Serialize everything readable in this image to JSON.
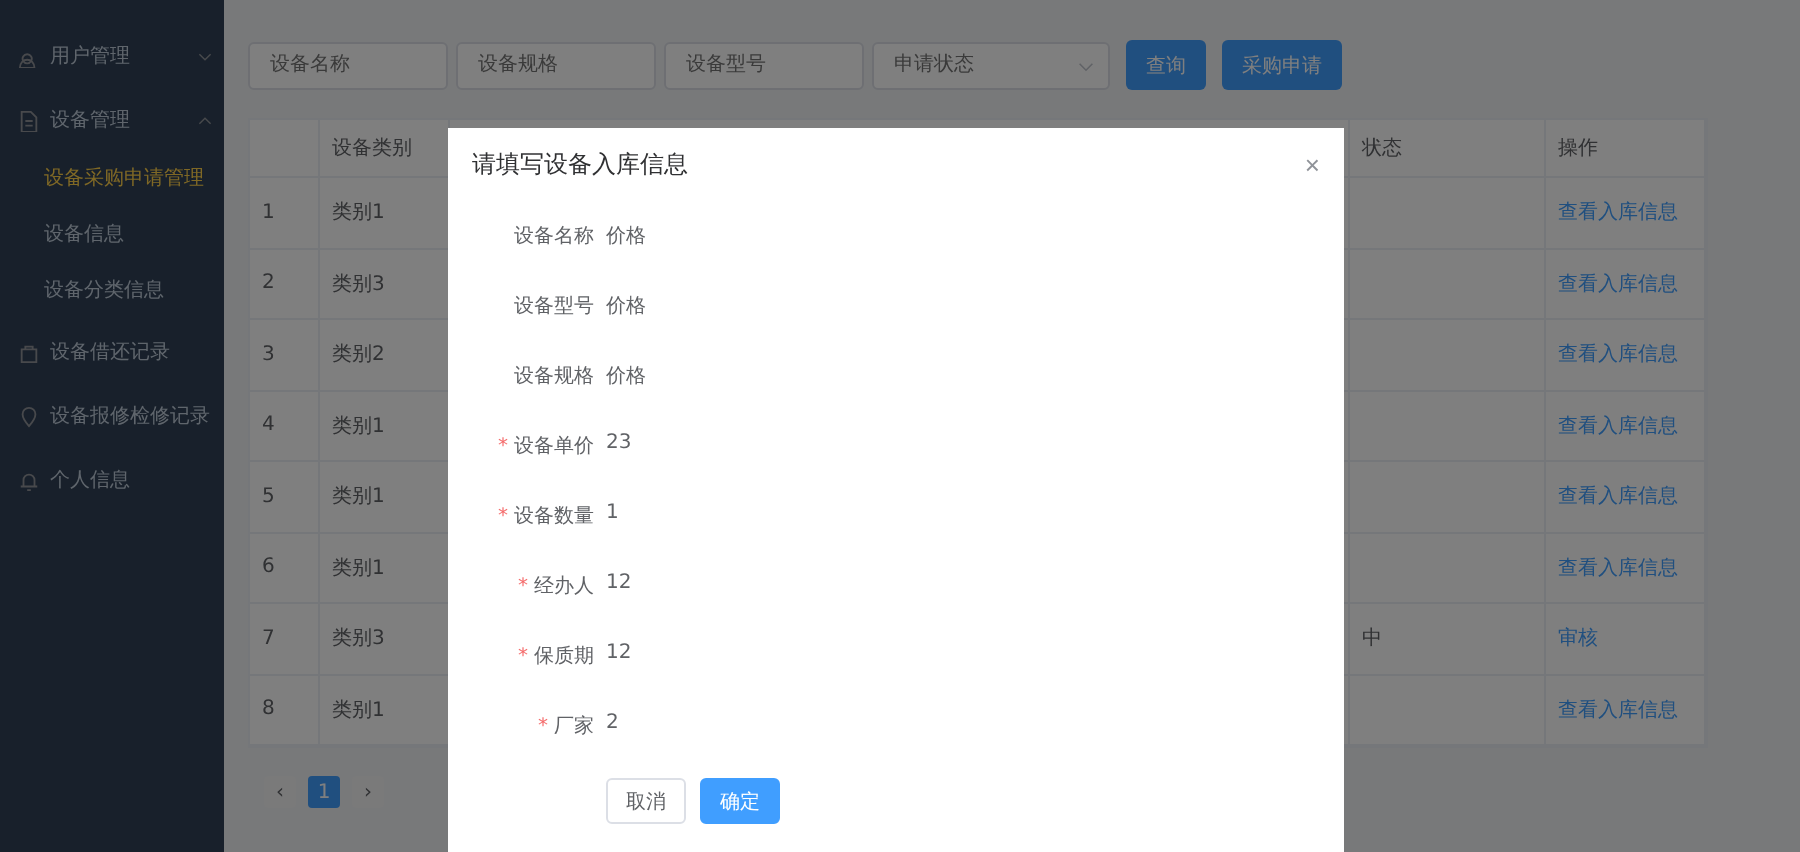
{
  "sidebar": {
    "items": [
      {
        "label": "用户管理",
        "expanded": false,
        "selected": false
      },
      {
        "label": "设备管理",
        "expanded": true,
        "selected": false,
        "children": [
          {
            "label": "设备采购申请管理",
            "selected": true
          },
          {
            "label": "设备信息",
            "selected": false
          },
          {
            "label": "设备分类信息",
            "selected": false
          }
        ]
      },
      {
        "label": "设备借还记录",
        "selected": false
      },
      {
        "label": "设备报修检修记录",
        "selected": false
      },
      {
        "label": "个人信息",
        "selected": false
      }
    ]
  },
  "filters": {
    "fields": [
      {
        "kind": "input",
        "placeholder": "设备名称"
      },
      {
        "kind": "input",
        "placeholder": "设备规格"
      },
      {
        "kind": "input",
        "placeholder": "设备型号"
      },
      {
        "kind": "select",
        "placeholder": "申请状态"
      }
    ],
    "buttons": [
      "查询",
      "采购申请"
    ]
  },
  "table": {
    "columns": [
      null,
      "设备类别",
      null,
      "状态",
      "操作"
    ],
    "rows": [
      {
        "index": "1",
        "category": "类别1",
        "action": "查看入库信息"
      },
      {
        "index": "2",
        "category": "类别3",
        "action": "查看入库信息"
      },
      {
        "index": "3",
        "category": "类别2",
        "action": "查看入库信息"
      },
      {
        "index": "4",
        "category": "类别1",
        "action": "查看入库信息"
      },
      {
        "index": "5",
        "category": "类别1",
        "action": "查看入库信息"
      },
      {
        "index": "6",
        "category": "类别1",
        "action": "查看入库信息"
      },
      {
        "index": "7",
        "category": "类别3",
        "status": "中",
        "action": "审核"
      },
      {
        "index": "8",
        "category": "类别1",
        "action": "查看入库信息"
      }
    ]
  },
  "pagination": {
    "prev": "‹",
    "next": "›",
    "pages": [
      {
        "label": "1",
        "selected": true
      }
    ]
  },
  "dialog": {
    "title": "请填写设备入库信息",
    "close": "×",
    "required_mark": "*",
    "fields": [
      {
        "label": "设备名称",
        "value": "价格",
        "required": false
      },
      {
        "label": "设备型号",
        "value": "价格",
        "required": false
      },
      {
        "label": "设备规格",
        "value": "价格",
        "required": false
      },
      {
        "label": "设备单价",
        "value": "23",
        "required": true
      },
      {
        "label": "设备数量",
        "value": "1",
        "required": true
      },
      {
        "label": "经办人",
        "value": "12",
        "required": true
      },
      {
        "label": "保质期",
        "value": "12",
        "required": true
      },
      {
        "label": "厂家",
        "value": "2",
        "required": true
      }
    ],
    "buttons": [
      {
        "label": "取消",
        "kind": "default"
      },
      {
        "label": "确定",
        "kind": "primary"
      }
    ]
  }
}
